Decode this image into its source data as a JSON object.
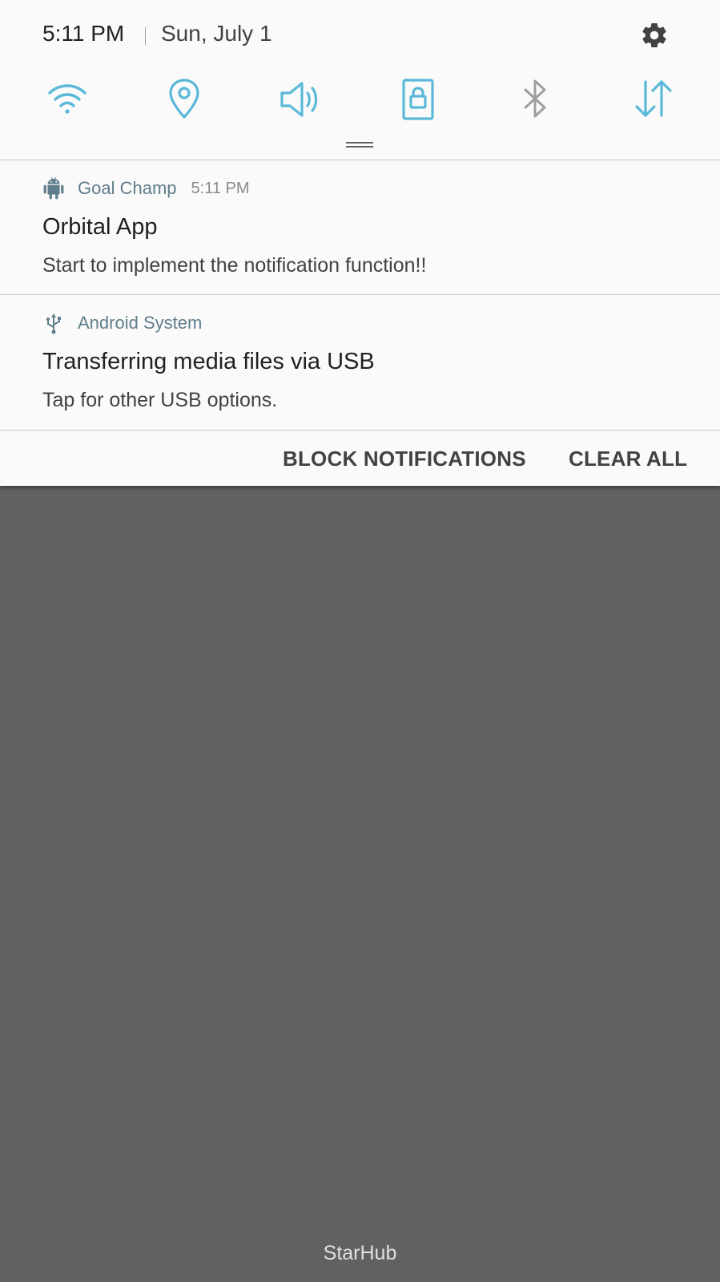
{
  "header": {
    "time": "5:11 PM",
    "date": "Sun, July 1",
    "settings_icon": "gear-icon"
  },
  "quick_settings": [
    {
      "name": "wifi",
      "icon": "wifi-icon",
      "active": true
    },
    {
      "name": "location",
      "icon": "location-pin-icon",
      "active": true
    },
    {
      "name": "sound",
      "icon": "speaker-icon",
      "active": true
    },
    {
      "name": "screen-rotation-lock",
      "icon": "lock-screen-icon",
      "active": true
    },
    {
      "name": "bluetooth",
      "icon": "bluetooth-icon",
      "active": false
    },
    {
      "name": "mobile-data",
      "icon": "data-arrows-icon",
      "active": true
    }
  ],
  "colors": {
    "accent": "#5bb8d8",
    "inactive": "#9e9e9e",
    "shade_bg": "#fafafa",
    "backdrop": "#616161",
    "app_name": "#607d8b"
  },
  "notifications": [
    {
      "app_icon": "android-icon",
      "app_name": "Goal Champ",
      "time": "5:11 PM",
      "title": "Orbital App",
      "text": "Start to implement the notification function!!"
    },
    {
      "app_icon": "usb-icon",
      "app_name": "Android System",
      "time": "",
      "title": "Transferring media files via USB",
      "text": "Tap for other USB options."
    }
  ],
  "actions": {
    "block_label": "BLOCK NOTIFICATIONS",
    "clear_label": "CLEAR ALL"
  },
  "carrier": "StarHub"
}
